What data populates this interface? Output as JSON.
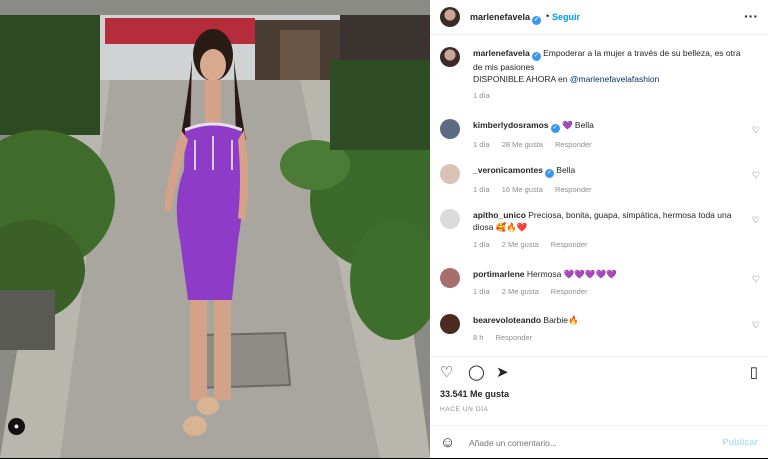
{
  "post": {
    "username": "marlenefavela",
    "follow_label": "Seguir",
    "caption": {
      "text": "Empoderar a la mujer a través de su belleza, es otra de mis pasiones",
      "line2": "DISPONIBLE AHORA en",
      "mention": "@marlenefavelafashion",
      "time": "1 día"
    },
    "likes": "33.541 Me gusta",
    "posted": "HACE UN DÍA",
    "comment_placeholder": "Añade un comentario...",
    "publish_label": "Publicar"
  },
  "comments": [
    {
      "user": "kimberlydosramos",
      "verified": true,
      "text": "💜 Bella",
      "time": "1 día",
      "likes": "28 Me gusta",
      "reply": "Responder"
    },
    {
      "user": "_veronicamontes",
      "verified": true,
      "text": "Bella",
      "time": "1 día",
      "likes": "16 Me gusta",
      "reply": "Responder"
    },
    {
      "user": "apitho_unico",
      "verified": false,
      "text": "Preciosa, bonita, guapa, simpática, hermosa toda una diosa 🥰🔥❤️",
      "time": "1 día",
      "likes": "2 Me gusta",
      "reply": "Responder"
    },
    {
      "user": "portimarlene",
      "verified": false,
      "text": "Hermosa 💜💜💜💜💜",
      "time": "1 día",
      "likes": "2 Me gusta",
      "reply": "Responder"
    },
    {
      "user": "bearevoloteando",
      "verified": false,
      "text": "Barbie🔥",
      "time": "8 h",
      "likes": "",
      "reply": "Responder"
    }
  ],
  "colors": {
    "accent": "#0095f6",
    "dress": "#8e3cc8",
    "bg": "#ffffff"
  }
}
